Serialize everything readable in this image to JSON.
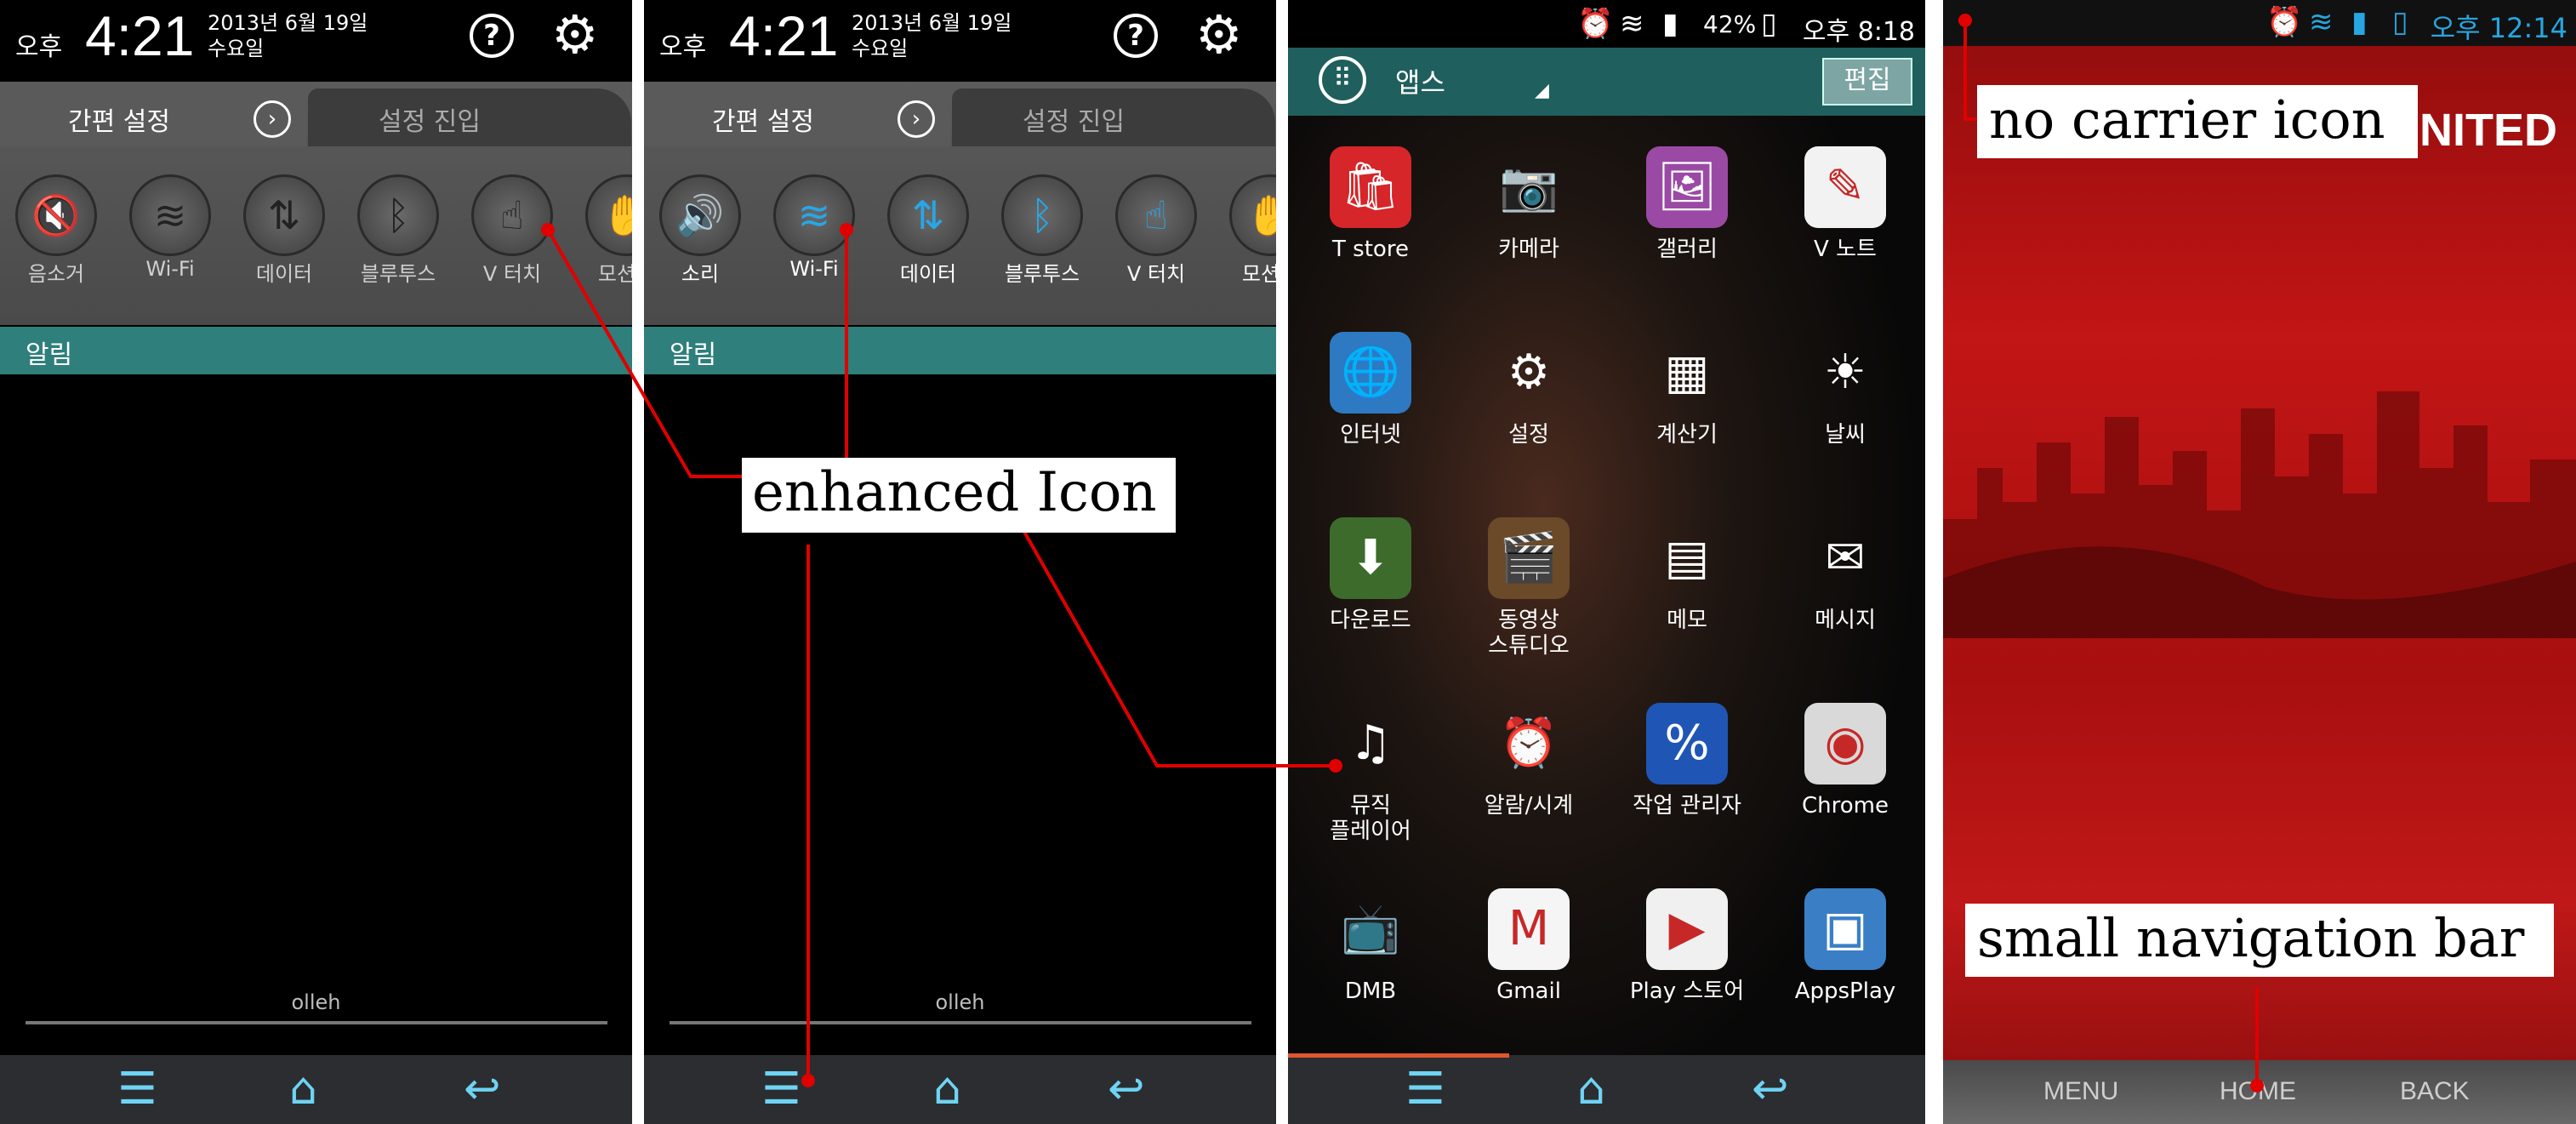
{
  "panel_left": {
    "ampm": "오후",
    "clock": "4:21",
    "date_line1": "2013년 6월 19일",
    "date_line2": "수요일",
    "tab_active": "간편 설정",
    "tab_inactive": "설정 진입",
    "toggles": [
      "음소거",
      "Wi-Fi",
      "데이터",
      "블루투스",
      "V 터치",
      "모션의"
    ],
    "alert_label": "알림",
    "carrier": "olleh"
  },
  "panel_right": {
    "ampm": "오후",
    "clock": "4:21",
    "date_line1": "2013년 6월 19일",
    "date_line2": "수요일",
    "tab_active": "간편 설정",
    "tab_inactive": "설정 진입",
    "toggles": [
      "소리",
      "Wi-Fi",
      "데이터",
      "블루투스",
      "V 터치",
      "모션의"
    ],
    "alert_label": "알림",
    "carrier": "olleh"
  },
  "app_drawer": {
    "status_battery": "42%",
    "status_time": "오후 8:18",
    "title": "앱스",
    "edit_label": "편집",
    "apps": [
      {
        "label": "T store",
        "icon": "tstore-icon"
      },
      {
        "label": "카메라",
        "icon": "camera-icon"
      },
      {
        "label": "갤러리",
        "icon": "gallery-icon"
      },
      {
        "label": "V 노트",
        "icon": "vnote-icon"
      },
      {
        "label": "인터넷",
        "icon": "internet-icon"
      },
      {
        "label": "설정",
        "icon": "settings-icon"
      },
      {
        "label": "계산기",
        "icon": "calculator-icon"
      },
      {
        "label": "날씨",
        "icon": "weather-icon"
      },
      {
        "label": "다운로드",
        "icon": "download-icon"
      },
      {
        "label": "동영상\n스튜디오",
        "icon": "video-studio-icon"
      },
      {
        "label": "메모",
        "icon": "memo-icon"
      },
      {
        "label": "메시지",
        "icon": "message-icon"
      },
      {
        "label": "뮤직\n플레이어",
        "icon": "music-icon"
      },
      {
        "label": "알람/시계",
        "icon": "alarm-clock-icon"
      },
      {
        "label": "작업 관리자",
        "icon": "task-manager-icon"
      },
      {
        "label": "Chrome",
        "icon": "chrome-icon"
      },
      {
        "label": "DMB",
        "icon": "dmb-icon"
      },
      {
        "label": "Gmail",
        "icon": "gmail-icon"
      },
      {
        "label": "Play 스토어",
        "icon": "play-store-icon"
      },
      {
        "label": "AppsPlay",
        "icon": "appsplay-icon"
      }
    ]
  },
  "game_screen": {
    "status_time": "오후 12:14",
    "logo_text": "NITED",
    "soft_keys": [
      "MENU",
      "HOME",
      "BACK"
    ]
  },
  "callouts": {
    "enhanced_icon": "enhanced Icon",
    "no_carrier_icon": "no carrier icon",
    "small_navigation_bar": "small navigation bar"
  },
  "colors": {
    "teal_bar": "#2f7f7c",
    "nav_icon": "#6fd3f3",
    "toggle_on": "#29a6e6",
    "annotation_line": "#e00000",
    "game_red": "#c21515"
  }
}
